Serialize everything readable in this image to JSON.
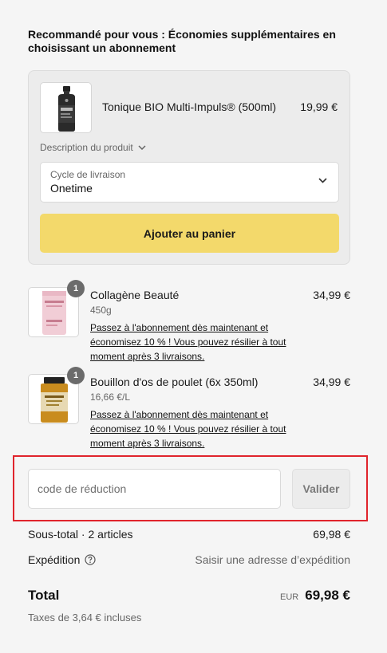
{
  "recommendation": {
    "title": "Recommandé pour vous : Économies supplémentaires en choisissant un abonnement",
    "product": {
      "name": "Tonique BIO Multi-Impuls® (500ml)",
      "price": "19,99 €",
      "description_toggle": "Description du produit",
      "thumbnail_icon": "dark-bottle-icon"
    },
    "delivery_cycle": {
      "label": "Cycle de livraison",
      "value": "Onetime"
    },
    "add_button": "Ajouter au panier",
    "accent_color": "#f3d96b"
  },
  "cart_items": [
    {
      "name": "Collagène Beauté",
      "quantity": "1",
      "meta": "450g",
      "price": "34,99 €",
      "promo": "Passez à l'abonnement dès maintenant et économisez 10 % ! Vous pouvez résilier à tout moment après 3 livraisons.",
      "thumbnail_icon": "pink-tub-icon"
    },
    {
      "name": "Bouillon d'os de poulet (6x 350ml)",
      "quantity": "1",
      "meta": "16,66 €/L",
      "price": "34,99 €",
      "promo": "Passez à l'abonnement dès maintenant et économisez 10 % ! Vous pouvez résilier à tout moment après 3 livraisons.",
      "thumbnail_icon": "broth-jar-icon"
    }
  ],
  "discount": {
    "placeholder": "code de réduction",
    "value": "",
    "button": "Valider",
    "highlight_color": "#e0242c"
  },
  "summary": {
    "subtotal_label": "Sous-total · 2 articles",
    "subtotal_value": "69,98 €",
    "shipping_label": "Expédition",
    "shipping_value": "Saisir une adresse d’expédition",
    "total_label": "Total",
    "currency": "EUR",
    "total_value": "69,98 €",
    "taxes": "Taxes de 3,64 € incluses"
  }
}
